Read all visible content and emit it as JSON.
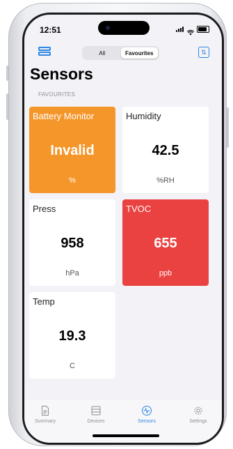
{
  "status": {
    "time": "12:51"
  },
  "header": {
    "segments": [
      "All",
      "Favourites"
    ],
    "selected": "Favourites"
  },
  "page": {
    "title": "Sensors",
    "section": "FAVOURITES"
  },
  "tiles": [
    {
      "name": "Battery Monitor",
      "value": "Invalid",
      "unit": "%",
      "color": "#f5962b"
    },
    {
      "name": "Humidity",
      "value": "42.5",
      "unit": "%RH",
      "color": "#ffffff"
    },
    {
      "name": "Press",
      "value": "958",
      "unit": "hPa",
      "color": "#ffffff"
    },
    {
      "name": "TVOC",
      "value": "655",
      "unit": "ppb",
      "color": "#e94241"
    },
    {
      "name": "Temp",
      "value": "19.3",
      "unit": "C",
      "color": "#ffffff"
    }
  ],
  "tabbar": {
    "tabs": [
      {
        "label": "Summary",
        "icon": "document-icon"
      },
      {
        "label": "Devices",
        "icon": "devices-icon"
      },
      {
        "label": "Sensors",
        "icon": "sensors-icon"
      },
      {
        "label": "Settings",
        "icon": "gear-icon"
      }
    ],
    "active": "Sensors"
  },
  "colors": {
    "accent": "#2f86e4",
    "background": "#f2f2f7"
  }
}
